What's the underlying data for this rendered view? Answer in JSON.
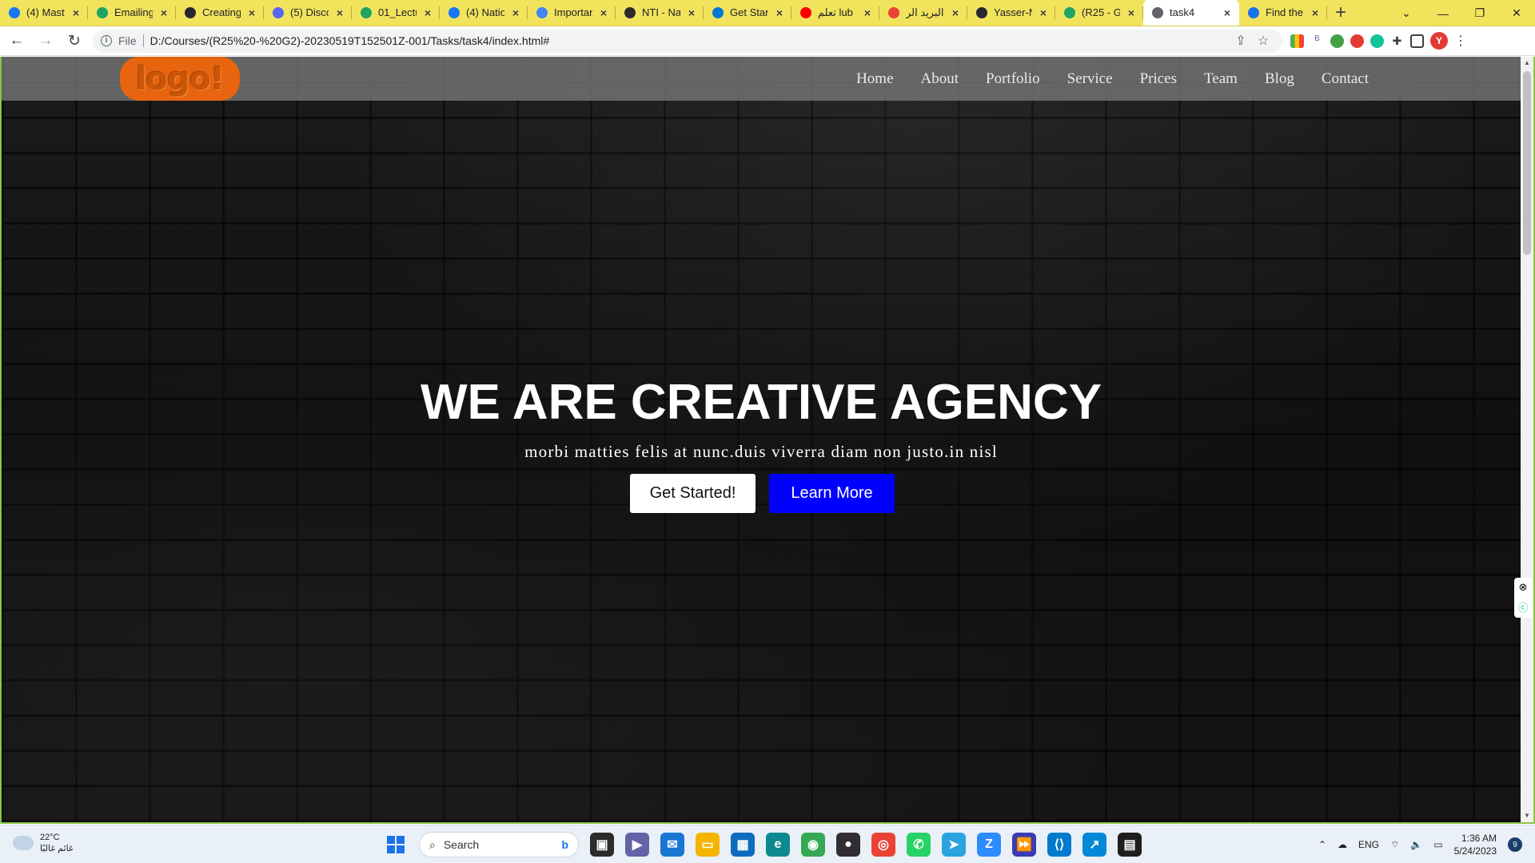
{
  "browser": {
    "tabs": [
      {
        "title": "(4) Mast",
        "icon": "facebook-icon",
        "color": "#1877f2"
      },
      {
        "title": "Emailing",
        "icon": "drive-icon",
        "color": "#1fa463"
      },
      {
        "title": "Creating",
        "icon": "github-icon",
        "color": "#24292f"
      },
      {
        "title": "(5) Disco",
        "icon": "discord-icon",
        "color": "#5865f2"
      },
      {
        "title": "01_Lectu",
        "icon": "drive-icon",
        "color": "#1fa463"
      },
      {
        "title": "(4) Natio",
        "icon": "facebook-icon",
        "color": "#1877f2"
      },
      {
        "title": "Importar",
        "icon": "docs-icon",
        "color": "#4285f4"
      },
      {
        "title": "NTI - Na",
        "icon": "nti-icon",
        "color": "#2b2b2b"
      },
      {
        "title": "Get Star",
        "icon": "vscode-icon",
        "color": "#0078d4"
      },
      {
        "title": "تعلم lub",
        "icon": "youtube-icon",
        "color": "#ff0000"
      },
      {
        "title": "البريد الر",
        "icon": "gmail-icon",
        "color": "#ea4335"
      },
      {
        "title": "Yasser-N",
        "icon": "github-icon",
        "color": "#24292f"
      },
      {
        "title": "(R25 - G",
        "icon": "drive-icon",
        "color": "#1fa463"
      },
      {
        "title": "task4",
        "icon": "globe-icon",
        "color": "#5f6368",
        "active": true
      },
      {
        "title": "Find the",
        "icon": "flag-icon",
        "color": "#1a73e8"
      }
    ],
    "new_tab": "+",
    "url_scheme": "File",
    "url": "D:/Courses/(R25%20-%20G2)-20230519T152501Z-001/Tasks/task4/index.html#",
    "profile_initial": "Y"
  },
  "site": {
    "logo_text": "logo!",
    "nav": [
      "Home",
      "About",
      "Portfolio",
      "Service",
      "Prices",
      "Team",
      "Blog",
      "Contact"
    ],
    "hero": {
      "heading": "WE ARE CREATIVE AGENCY",
      "subtitle": "morbi matties felis at nunc.duis viverra diam non justo.in nisl",
      "primary_button": "Get Started!",
      "secondary_button": "Learn More"
    },
    "colors": {
      "logo": "#e8640f",
      "secondary_button": "#0000ff"
    }
  },
  "taskbar": {
    "temperature": "22°C",
    "weather_text": "غائم غالبًا",
    "search_placeholder": "Search",
    "language": "ENG",
    "time": "1:36 AM",
    "date": "5/24/2023",
    "notifications": "9"
  }
}
